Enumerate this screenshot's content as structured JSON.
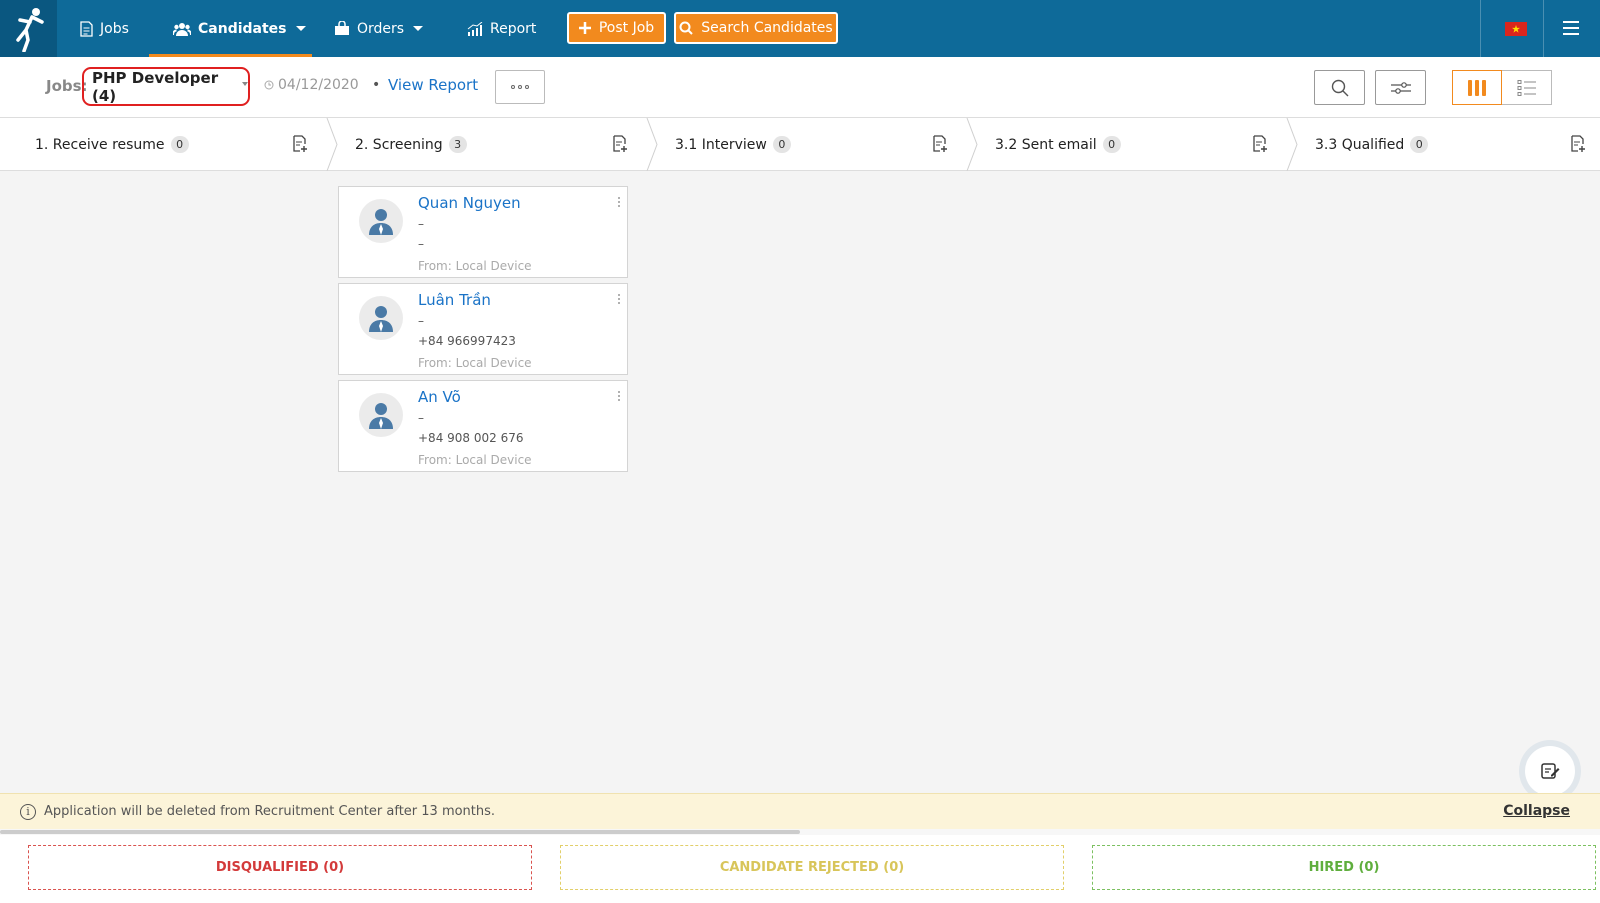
{
  "nav": {
    "items": [
      {
        "label": "Jobs",
        "icon": "document-icon"
      },
      {
        "label": "Candidates",
        "icon": "people-icon"
      },
      {
        "label": "Orders",
        "icon": "bag-icon"
      },
      {
        "label": "Report",
        "icon": "chart-icon"
      }
    ],
    "post_job": "Post Job",
    "search_candidates": "Search Candidates",
    "flag": "Vietnam flag",
    "accent_color": "#f28a1e",
    "brand_color": "#0e6a99"
  },
  "subheader": {
    "jobs_label": "Jobs:",
    "job_title": "PHP Developer (4)",
    "date": "04/12/2020",
    "dot": "•",
    "view_report": "View Report"
  },
  "stages": [
    {
      "label": "1. Receive resume",
      "count": "0"
    },
    {
      "label": "2. Screening",
      "count": "3"
    },
    {
      "label": "3.1 Interview",
      "count": "0"
    },
    {
      "label": "3.2 Sent email",
      "count": "0"
    },
    {
      "label": "3.3 Qualified",
      "count": "0"
    }
  ],
  "candidates": [
    {
      "name": "Quan Nguyen",
      "line1": "–",
      "line2": "–",
      "source": "From: Local Device"
    },
    {
      "name": "Luân Trần",
      "line1": "–",
      "line2": "+84 966997423",
      "source": "From: Local Device"
    },
    {
      "name": "An Võ",
      "line1": "–",
      "line2": "+84 908 002 676",
      "source": "From: Local Device"
    }
  ],
  "notice": {
    "text": "Application will be deleted from Recruitment Center after 13 months.",
    "collapse": "Collapse"
  },
  "dropzones": {
    "disqualified": "DISQUALIFIED (0)",
    "rejected": "CANDIDATE REJECTED (0)",
    "hired": "HIRED (0)"
  }
}
